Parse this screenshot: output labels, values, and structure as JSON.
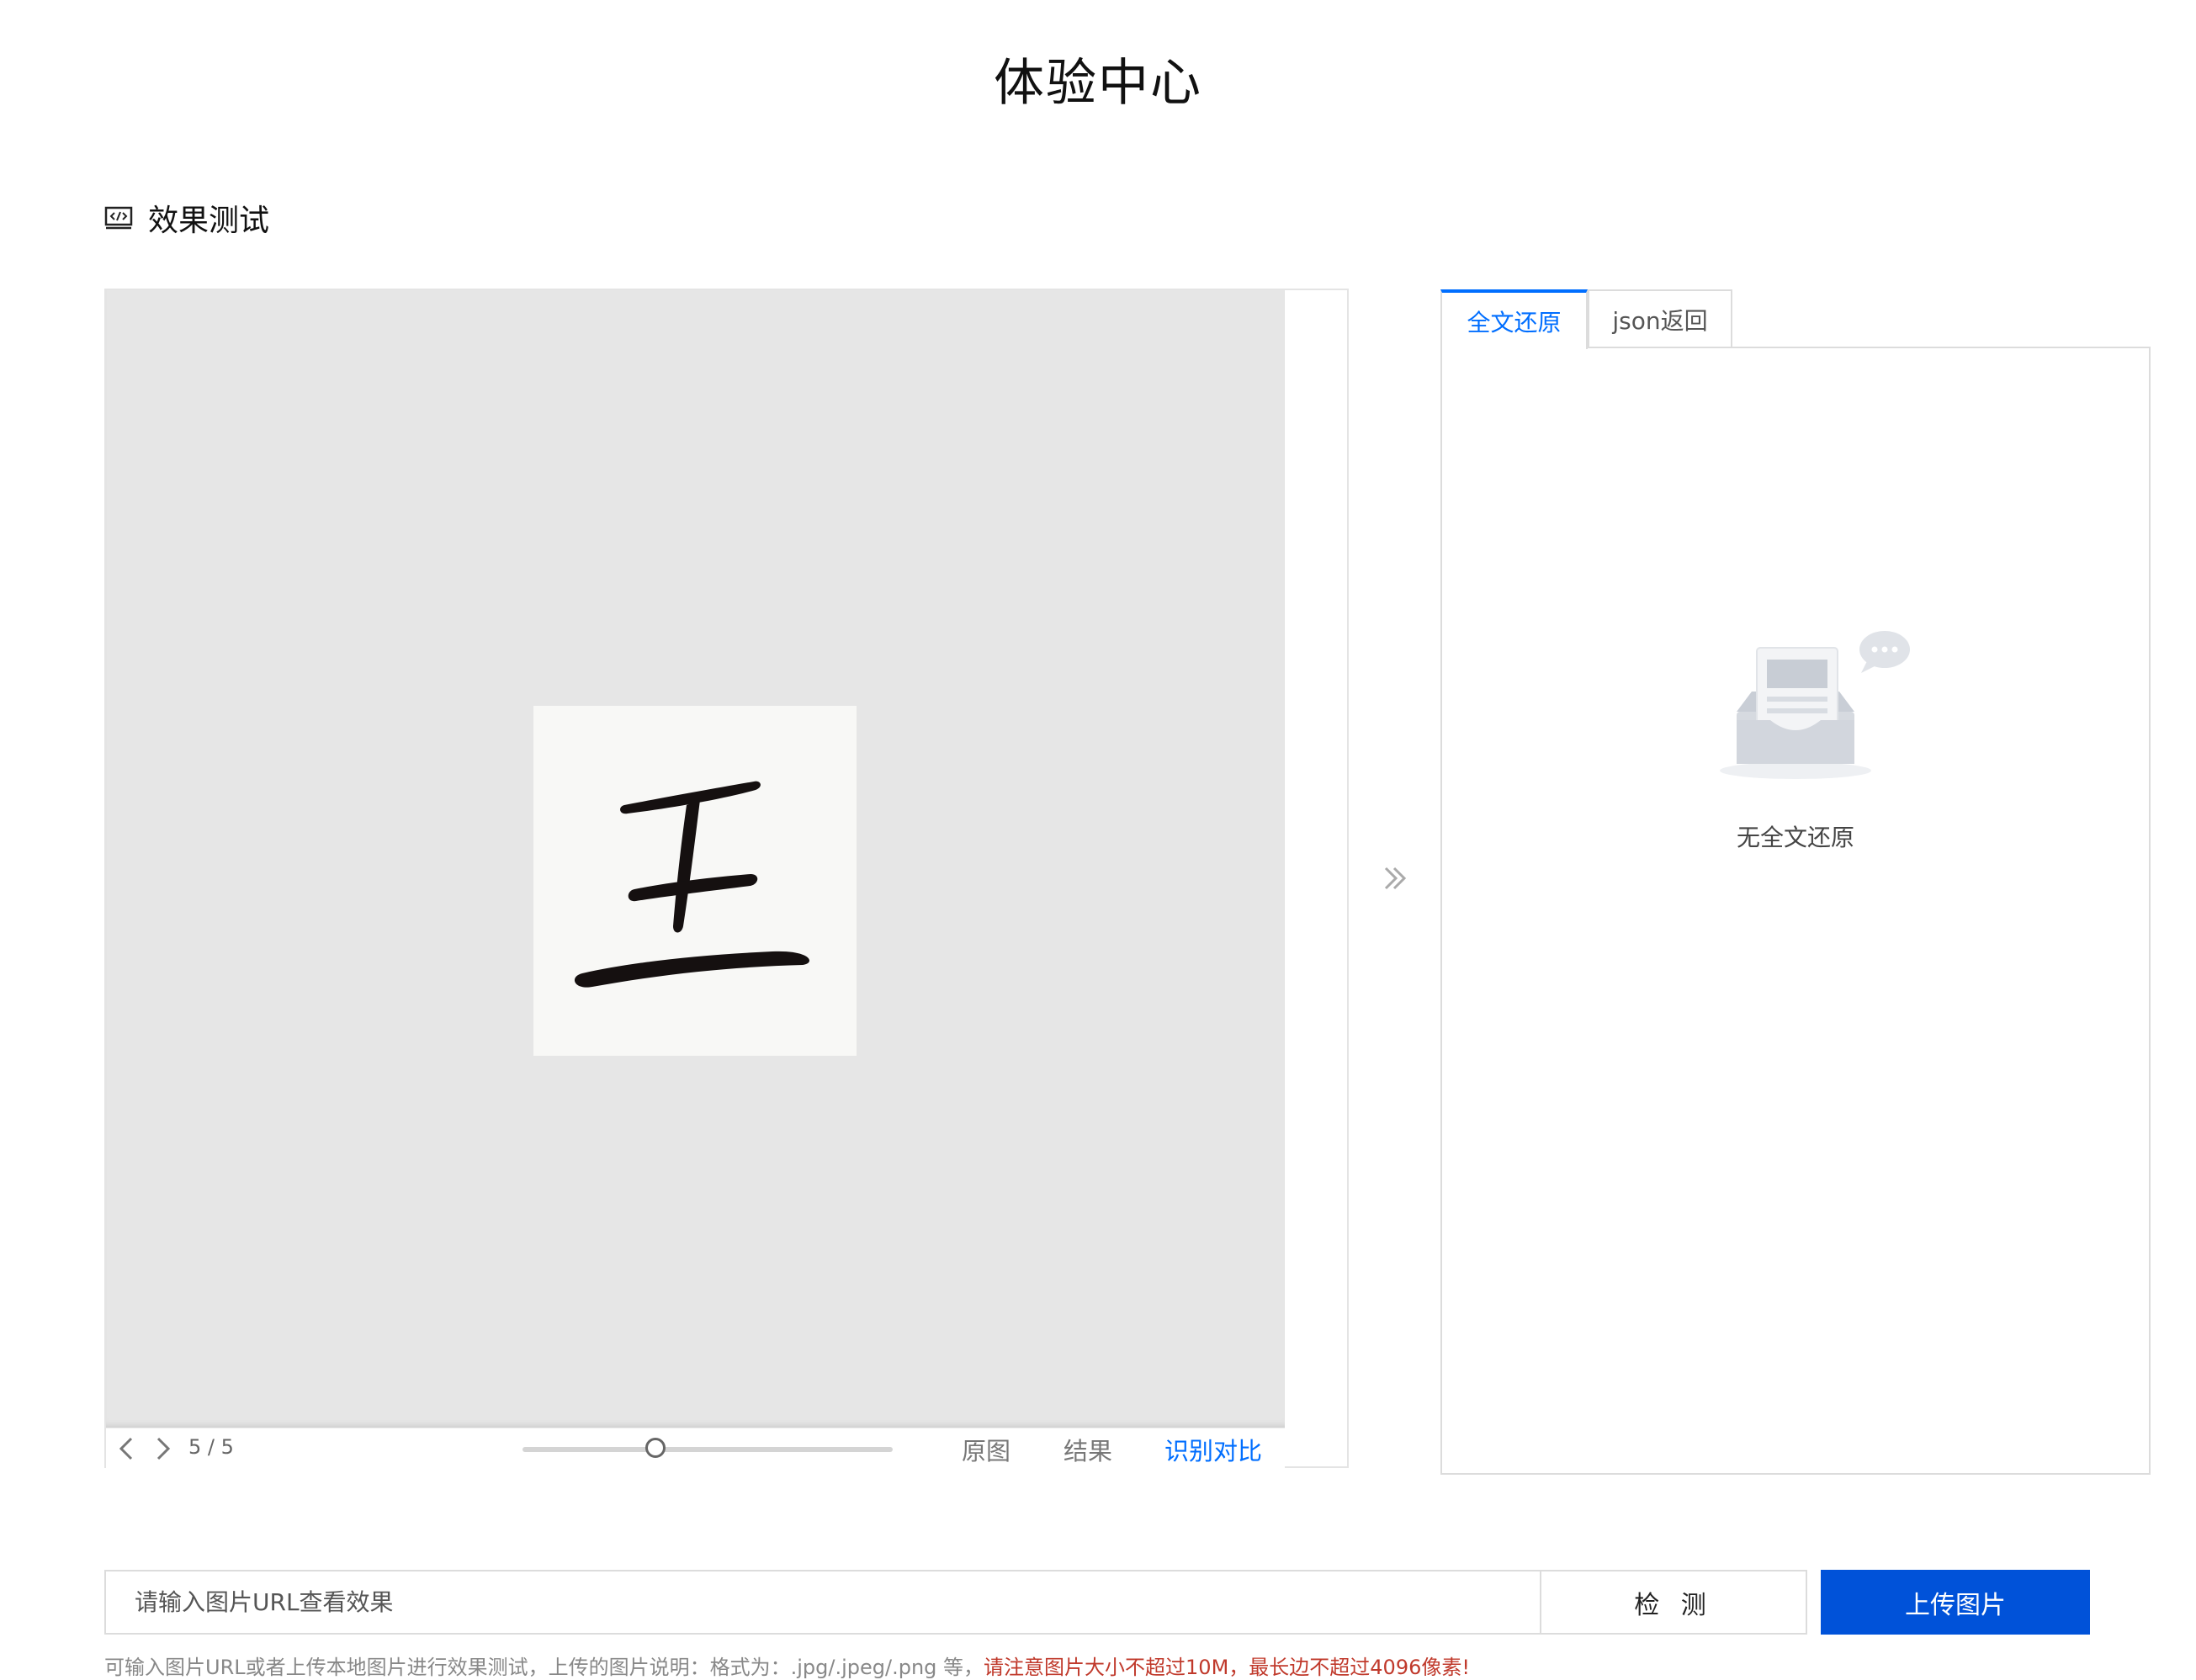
{
  "page": {
    "title": "体验中心"
  },
  "section": {
    "icon": "code-window-icon",
    "label": "效果测试"
  },
  "viewer": {
    "page_counter": "5 / 5",
    "zoom_level": 0.36,
    "view_modes": [
      "原图",
      "结果",
      "识别对比"
    ],
    "active_view_mode": "识别对比",
    "image_character": "王"
  },
  "result": {
    "tabs": [
      "全文还原",
      "json返回"
    ],
    "active_tab": "全文还原",
    "empty_text": "无全文还原"
  },
  "input": {
    "url_placeholder": "请输入图片URL查看效果",
    "detect_label": "检 测",
    "upload_label": "上传图片"
  },
  "footnote": {
    "normal": "可输入图片URL或者上传本地图片进行效果测试，上传的图片说明：格式为：.jpg/.jpeg/.png 等，",
    "warning": "请注意图片大小不超过10M，最长边不超过4096像素!"
  },
  "colors": {
    "accent": "#006eff",
    "primary_button": "#0052d9",
    "warning": "#c0392b"
  }
}
